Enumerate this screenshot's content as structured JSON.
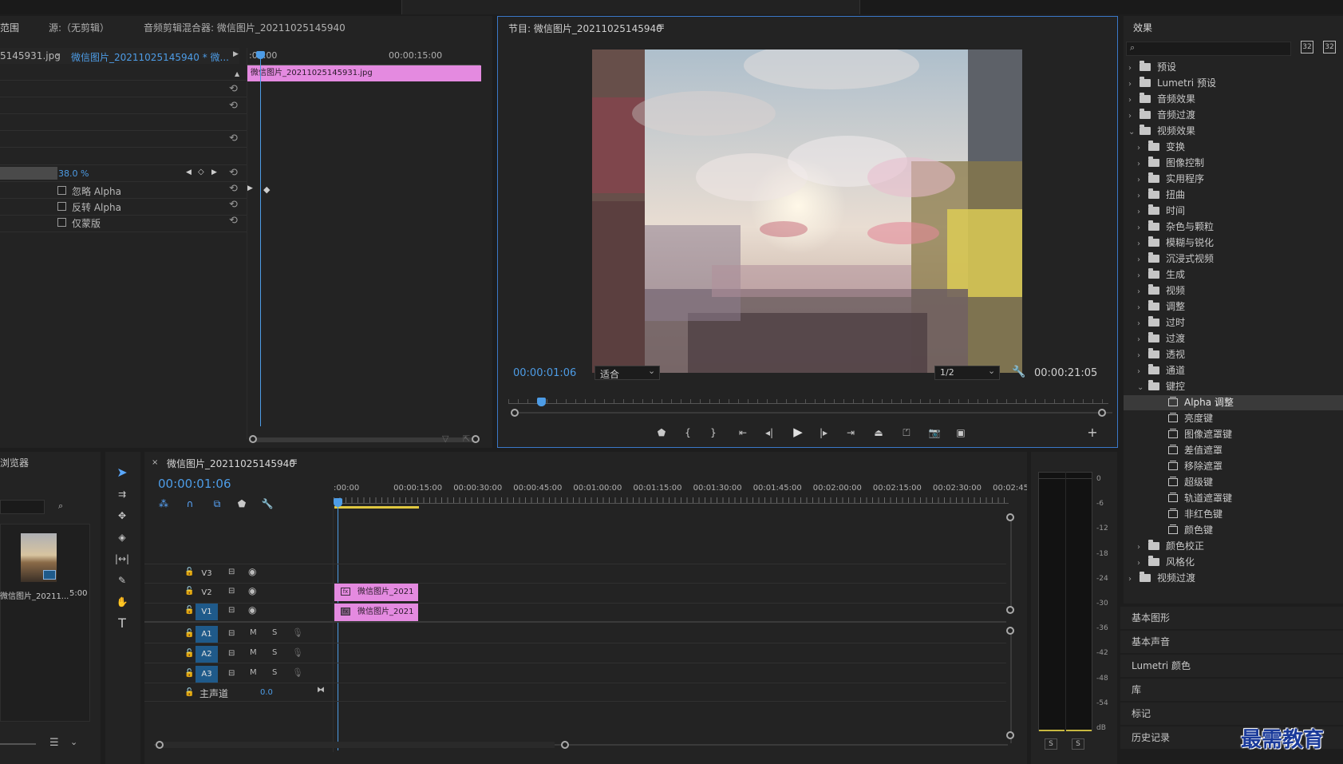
{
  "topbar": {
    "items": []
  },
  "effect_controls": {
    "tabs": [
      "范围",
      "源:（无剪辑）",
      "音频剪辑混合器: 微信图片_20211025145940"
    ],
    "source_clip": "5145931.jpg",
    "sequence_clip": "微信图片_20211025145940 * 微...",
    "timecode_start": ":00:00",
    "timecode_mid": "00:00:15:00",
    "clip_label": "微信图片_20211025145931.jpg",
    "opacity_value": "38.0 %",
    "checkboxes": [
      {
        "label": "忽略 Alpha",
        "checked": false
      },
      {
        "label": "反转 Alpha",
        "checked": false
      },
      {
        "label": "仅蒙版",
        "checked": false
      }
    ]
  },
  "program": {
    "title": "节目: 微信图片_20211025145940",
    "menu_icon": "hamburger-icon",
    "timecode": "00:00:01:06",
    "fit_label": "适合",
    "resolution": "1/2",
    "duration": "00:00:21:05"
  },
  "effects_panel": {
    "title": "效果",
    "search_placeholder": "",
    "tree": [
      {
        "label": "预设",
        "level": 0,
        "expanded": false,
        "type": "folder-star"
      },
      {
        "label": "Lumetri 预设",
        "level": 0,
        "expanded": false,
        "type": "folder-star"
      },
      {
        "label": "音频效果",
        "level": 0,
        "expanded": false,
        "type": "folder"
      },
      {
        "label": "音频过渡",
        "level": 0,
        "expanded": false,
        "type": "folder"
      },
      {
        "label": "视频效果",
        "level": 0,
        "expanded": true,
        "type": "folder"
      },
      {
        "label": "变换",
        "level": 1,
        "expanded": false,
        "type": "folder"
      },
      {
        "label": "图像控制",
        "level": 1,
        "expanded": false,
        "type": "folder"
      },
      {
        "label": "实用程序",
        "level": 1,
        "expanded": false,
        "type": "folder"
      },
      {
        "label": "扭曲",
        "level": 1,
        "expanded": false,
        "type": "folder"
      },
      {
        "label": "时间",
        "level": 1,
        "expanded": false,
        "type": "folder"
      },
      {
        "label": "杂色与颗粒",
        "level": 1,
        "expanded": false,
        "type": "folder"
      },
      {
        "label": "模糊与锐化",
        "level": 1,
        "expanded": false,
        "type": "folder"
      },
      {
        "label": "沉浸式视频",
        "level": 1,
        "expanded": false,
        "type": "folder"
      },
      {
        "label": "生成",
        "level": 1,
        "expanded": false,
        "type": "folder"
      },
      {
        "label": "视频",
        "level": 1,
        "expanded": false,
        "type": "folder"
      },
      {
        "label": "调整",
        "level": 1,
        "expanded": false,
        "type": "folder"
      },
      {
        "label": "过时",
        "level": 1,
        "expanded": false,
        "type": "folder"
      },
      {
        "label": "过渡",
        "level": 1,
        "expanded": false,
        "type": "folder"
      },
      {
        "label": "透视",
        "level": 1,
        "expanded": false,
        "type": "folder"
      },
      {
        "label": "通道",
        "level": 1,
        "expanded": false,
        "type": "folder"
      },
      {
        "label": "键控",
        "level": 1,
        "expanded": true,
        "type": "folder"
      },
      {
        "label": "Alpha 调整",
        "level": 2,
        "type": "fx",
        "selected": true
      },
      {
        "label": "亮度键",
        "level": 2,
        "type": "fx"
      },
      {
        "label": "图像遮罩键",
        "level": 2,
        "type": "fx"
      },
      {
        "label": "差值遮罩",
        "level": 2,
        "type": "fx"
      },
      {
        "label": "移除遮罩",
        "level": 2,
        "type": "fx"
      },
      {
        "label": "超级键",
        "level": 2,
        "type": "fx"
      },
      {
        "label": "轨道遮罩键",
        "level": 2,
        "type": "fx"
      },
      {
        "label": "非红色键",
        "level": 2,
        "type": "fx"
      },
      {
        "label": "颜色键",
        "level": 2,
        "type": "fx"
      },
      {
        "label": "颜色校正",
        "level": 1,
        "expanded": false,
        "type": "folder"
      },
      {
        "label": "风格化",
        "level": 1,
        "expanded": false,
        "type": "folder"
      },
      {
        "label": "视频过渡",
        "level": 0,
        "expanded": false,
        "type": "folder"
      }
    ],
    "bottom_panels": [
      "基本图形",
      "基本声音",
      "Lumetri 颜色",
      "库",
      "标记",
      "历史记录"
    ]
  },
  "project_panel": {
    "title": "浏览器",
    "item_label": "微信图片_20211...",
    "item_duration": "5:00"
  },
  "timeline": {
    "sequence_name": "微信图片_20211025145940",
    "timecode": "00:00:01:06",
    "ruler": [
      ":00:00",
      "00:00:15:00",
      "00:00:30:00",
      "00:00:45:00",
      "00:01:00:00",
      "00:01:15:00",
      "00:01:30:00",
      "00:01:45:00",
      "00:02:00:00",
      "00:02:15:00",
      "00:02:30:00",
      "00:02:45:"
    ],
    "video_tracks": [
      {
        "name": "V3",
        "active": false
      },
      {
        "name": "V2",
        "active": false
      },
      {
        "name": "V1",
        "active": true
      }
    ],
    "audio_tracks": [
      {
        "name": "A1",
        "m": "M",
        "s": "S"
      },
      {
        "name": "A2",
        "m": "M",
        "s": "S"
      },
      {
        "name": "A3",
        "m": "M",
        "s": "S"
      }
    ],
    "master_label": "主声道",
    "master_value": "0.0",
    "clips": [
      {
        "track": "V2",
        "label": "微信图片_2021"
      },
      {
        "track": "V1",
        "label": "微信图片_2021"
      }
    ]
  },
  "audio_meter": {
    "scale": [
      "0",
      "-6",
      "-12",
      "-18",
      "-24",
      "-30",
      "-36",
      "-42",
      "-48",
      "-54",
      "dB"
    ],
    "solo": [
      "S",
      "S"
    ]
  },
  "watermark": "最需教育"
}
